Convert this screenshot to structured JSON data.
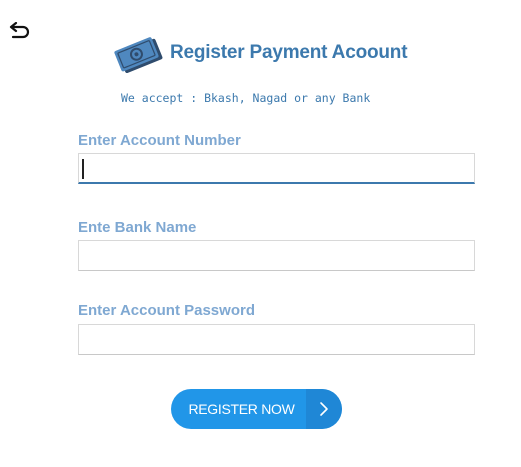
{
  "header": {
    "title": "Register Payment Acoount",
    "back_icon": "back-arrow-icon",
    "logo_icon": "money-bills-icon"
  },
  "subtitle": "We accept : Bkash, Nagad or any Bank",
  "form": {
    "account_number": {
      "label": "Enter Account Number",
      "value": "",
      "placeholder": ""
    },
    "bank_name": {
      "label": "Ente Bank Name",
      "value": "",
      "placeholder": ""
    },
    "account_password": {
      "label": "Enter Account Password",
      "value": "",
      "placeholder": ""
    }
  },
  "submit": {
    "label": "REGISTER NOW",
    "icon": "chevron-right-icon"
  },
  "colors": {
    "title": "#3c79ad",
    "label": "#7fa8d2",
    "button": "#2196e8",
    "button_arrow_bg": "#1f87d6"
  }
}
